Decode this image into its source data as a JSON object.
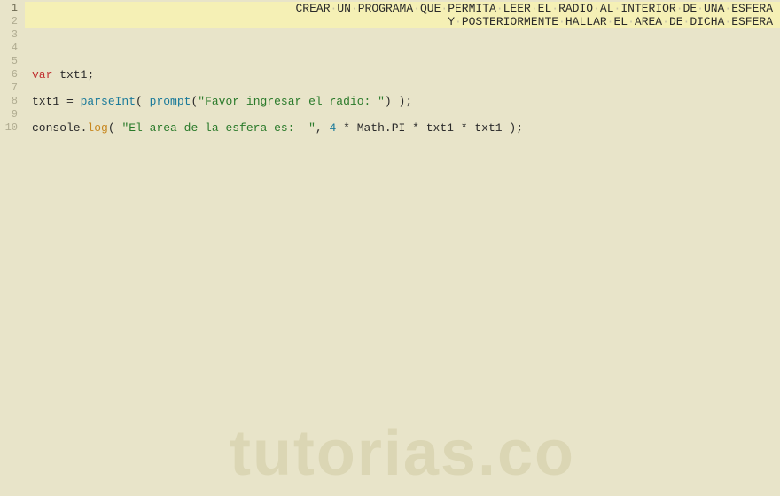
{
  "gutter": {
    "line_count": 10,
    "active_line": 1
  },
  "code": {
    "line1": {
      "comment_text": "CREAR UN PROGRAMA QUE PERMITA LEER EL RADIO AL INTERIOR DE UNA ESFERA"
    },
    "line2": {
      "comment_text": "Y POSTERIORMENTE HALLAR EL AREA DE DICHA ESFERA"
    },
    "line6": {
      "var_kw": "var",
      "ident": "txt1",
      "semi": ";"
    },
    "line8": {
      "ident": "txt1",
      "eq": " = ",
      "parseInt": "parseInt",
      "open": "( ",
      "prompt": "prompt",
      "popen": "(",
      "str": "\"Favor ingresar el radio: \"",
      "pclose": ")",
      "close": " );"
    },
    "line10": {
      "console": "console",
      "dot": ".",
      "log": "log",
      "open": "( ",
      "str": "\"El area de la esfera es:  \"",
      "comma": ", ",
      "num": "4",
      "mul1": " * ",
      "math": "Math",
      "dot2": ".",
      "pi": "PI",
      "mul2": " * ",
      "t1": "txt1",
      "mul3": " * ",
      "t2": "txt1",
      "close": " );"
    }
  },
  "watermark": "tutorias.co"
}
